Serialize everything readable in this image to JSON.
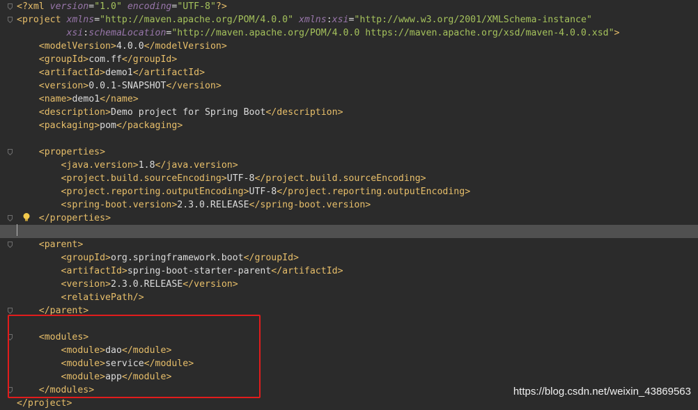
{
  "editor": {
    "lines": [
      {
        "indent": "",
        "parts": [
          [
            "lt",
            "<?"
          ],
          [
            "el",
            "xml "
          ],
          [
            "attrn",
            "version"
          ],
          [
            "txt",
            "="
          ],
          [
            "str",
            "\"1.0\""
          ],
          [
            "txt",
            " "
          ],
          [
            "attrn",
            "encoding"
          ],
          [
            "txt",
            "="
          ],
          [
            "str",
            "\"UTF-8\""
          ],
          [
            "lt",
            "?>"
          ]
        ]
      },
      {
        "indent": "",
        "parts": [
          [
            "lt",
            "<"
          ],
          [
            "el",
            "project "
          ],
          [
            "attrn",
            "xmlns"
          ],
          [
            "txt",
            "="
          ],
          [
            "str",
            "\"http://maven.apache.org/POM/4.0.0\""
          ],
          [
            "txt",
            " "
          ],
          [
            "attrn",
            "xmlns"
          ],
          [
            "txt",
            ":"
          ],
          [
            "attrn",
            "xsi"
          ],
          [
            "txt",
            "="
          ],
          [
            "str",
            "\"http://www.w3.org/2001/XMLSchema-instance\""
          ]
        ]
      },
      {
        "indent": "         ",
        "parts": [
          [
            "attrn",
            "xsi"
          ],
          [
            "txt",
            ":"
          ],
          [
            "attrn",
            "schemaLocation"
          ],
          [
            "txt",
            "="
          ],
          [
            "str",
            "\"http://maven.apache.org/POM/4.0.0 https://maven.apache.org/xsd/maven-4.0.0.xsd\""
          ],
          [
            "lt",
            ">"
          ]
        ]
      },
      {
        "indent": "    ",
        "parts": [
          [
            "lt",
            "<"
          ],
          [
            "el",
            "modelVersion"
          ],
          [
            "lt",
            ">"
          ],
          [
            "txt",
            "4.0.0"
          ],
          [
            "lt",
            "</"
          ],
          [
            "el",
            "modelVersion"
          ],
          [
            "lt",
            ">"
          ]
        ]
      },
      {
        "indent": "    ",
        "parts": [
          [
            "lt",
            "<"
          ],
          [
            "el",
            "groupId"
          ],
          [
            "lt",
            ">"
          ],
          [
            "txt",
            "com.ff"
          ],
          [
            "lt",
            "</"
          ],
          [
            "el",
            "groupId"
          ],
          [
            "lt",
            ">"
          ]
        ]
      },
      {
        "indent": "    ",
        "parts": [
          [
            "lt",
            "<"
          ],
          [
            "el",
            "artifactId"
          ],
          [
            "lt",
            ">"
          ],
          [
            "txt",
            "demo1"
          ],
          [
            "lt",
            "</"
          ],
          [
            "el",
            "artifactId"
          ],
          [
            "lt",
            ">"
          ]
        ]
      },
      {
        "indent": "    ",
        "parts": [
          [
            "lt",
            "<"
          ],
          [
            "el",
            "version"
          ],
          [
            "lt",
            ">"
          ],
          [
            "txt",
            "0.0.1-SNAPSHOT"
          ],
          [
            "lt",
            "</"
          ],
          [
            "el",
            "version"
          ],
          [
            "lt",
            ">"
          ]
        ]
      },
      {
        "indent": "    ",
        "parts": [
          [
            "lt",
            "<"
          ],
          [
            "el",
            "name"
          ],
          [
            "lt",
            ">"
          ],
          [
            "txt",
            "demo1"
          ],
          [
            "lt",
            "</"
          ],
          [
            "el",
            "name"
          ],
          [
            "lt",
            ">"
          ]
        ]
      },
      {
        "indent": "    ",
        "parts": [
          [
            "lt",
            "<"
          ],
          [
            "el",
            "description"
          ],
          [
            "lt",
            ">"
          ],
          [
            "txt",
            "Demo project for Spring Boot"
          ],
          [
            "lt",
            "</"
          ],
          [
            "el",
            "description"
          ],
          [
            "lt",
            ">"
          ]
        ]
      },
      {
        "indent": "    ",
        "parts": [
          [
            "lt",
            "<"
          ],
          [
            "el",
            "packaging"
          ],
          [
            "lt",
            ">"
          ],
          [
            "txt",
            "pom"
          ],
          [
            "lt",
            "</"
          ],
          [
            "el",
            "packaging"
          ],
          [
            "lt",
            ">"
          ]
        ]
      },
      {
        "indent": "",
        "parts": []
      },
      {
        "indent": "    ",
        "parts": [
          [
            "lt",
            "<"
          ],
          [
            "el",
            "properties"
          ],
          [
            "lt",
            ">"
          ]
        ]
      },
      {
        "indent": "        ",
        "parts": [
          [
            "lt",
            "<"
          ],
          [
            "el",
            "java.version"
          ],
          [
            "lt",
            ">"
          ],
          [
            "txt",
            "1.8"
          ],
          [
            "lt",
            "</"
          ],
          [
            "el",
            "java.version"
          ],
          [
            "lt",
            ">"
          ]
        ]
      },
      {
        "indent": "        ",
        "parts": [
          [
            "lt",
            "<"
          ],
          [
            "el",
            "project.build.sourceEncoding"
          ],
          [
            "lt",
            ">"
          ],
          [
            "txt",
            "UTF-8"
          ],
          [
            "lt",
            "</"
          ],
          [
            "el",
            "project.build.sourceEncoding"
          ],
          [
            "lt",
            ">"
          ]
        ]
      },
      {
        "indent": "        ",
        "parts": [
          [
            "lt",
            "<"
          ],
          [
            "el",
            "project.reporting.outputEncoding"
          ],
          [
            "lt",
            ">"
          ],
          [
            "txt",
            "UTF-8"
          ],
          [
            "lt",
            "</"
          ],
          [
            "el",
            "project.reporting.outputEncoding"
          ],
          [
            "lt",
            ">"
          ]
        ]
      },
      {
        "indent": "        ",
        "parts": [
          [
            "lt",
            "<"
          ],
          [
            "el",
            "spring-boot.version"
          ],
          [
            "lt",
            ">"
          ],
          [
            "txt",
            "2.3.0.RELEASE"
          ],
          [
            "lt",
            "</"
          ],
          [
            "el",
            "spring-boot.version"
          ],
          [
            "lt",
            ">"
          ]
        ]
      },
      {
        "indent": "    ",
        "parts": [
          [
            "lt",
            "</"
          ],
          [
            "el",
            "properties"
          ],
          [
            "lt",
            ">"
          ]
        ]
      },
      {
        "indent": "",
        "parts": []
      },
      {
        "indent": "    ",
        "parts": [
          [
            "lt",
            "<"
          ],
          [
            "el",
            "parent"
          ],
          [
            "lt",
            ">"
          ]
        ]
      },
      {
        "indent": "        ",
        "parts": [
          [
            "lt",
            "<"
          ],
          [
            "el",
            "groupId"
          ],
          [
            "lt",
            ">"
          ],
          [
            "txt",
            "org.springframework.boot"
          ],
          [
            "lt",
            "</"
          ],
          [
            "el",
            "groupId"
          ],
          [
            "lt",
            ">"
          ]
        ]
      },
      {
        "indent": "        ",
        "parts": [
          [
            "lt",
            "<"
          ],
          [
            "el",
            "artifactId"
          ],
          [
            "lt",
            ">"
          ],
          [
            "txt",
            "spring-boot-starter-parent"
          ],
          [
            "lt",
            "</"
          ],
          [
            "el",
            "artifactId"
          ],
          [
            "lt",
            ">"
          ]
        ]
      },
      {
        "indent": "        ",
        "parts": [
          [
            "lt",
            "<"
          ],
          [
            "el",
            "version"
          ],
          [
            "lt",
            ">"
          ],
          [
            "txt",
            "2.3.0.RELEASE"
          ],
          [
            "lt",
            "</"
          ],
          [
            "el",
            "version"
          ],
          [
            "lt",
            ">"
          ]
        ]
      },
      {
        "indent": "        ",
        "parts": [
          [
            "lt",
            "<"
          ],
          [
            "el",
            "relativePath"
          ],
          [
            "lt",
            "/>"
          ]
        ]
      },
      {
        "indent": "    ",
        "parts": [
          [
            "lt",
            "</"
          ],
          [
            "el",
            "parent"
          ],
          [
            "lt",
            ">"
          ]
        ]
      },
      {
        "indent": "",
        "parts": []
      },
      {
        "indent": "    ",
        "parts": [
          [
            "lt",
            "<"
          ],
          [
            "el",
            "modules"
          ],
          [
            "lt",
            ">"
          ]
        ]
      },
      {
        "indent": "        ",
        "parts": [
          [
            "lt",
            "<"
          ],
          [
            "el",
            "module"
          ],
          [
            "lt",
            ">"
          ],
          [
            "txt",
            "dao"
          ],
          [
            "lt",
            "</"
          ],
          [
            "el",
            "module"
          ],
          [
            "lt",
            ">"
          ]
        ]
      },
      {
        "indent": "        ",
        "parts": [
          [
            "lt",
            "<"
          ],
          [
            "el",
            "module"
          ],
          [
            "lt",
            ">"
          ],
          [
            "txt",
            "service"
          ],
          [
            "lt",
            "</"
          ],
          [
            "el",
            "module"
          ],
          [
            "lt",
            ">"
          ]
        ]
      },
      {
        "indent": "        ",
        "parts": [
          [
            "lt",
            "<"
          ],
          [
            "el",
            "module"
          ],
          [
            "lt",
            ">"
          ],
          [
            "txt",
            "app"
          ],
          [
            "lt",
            "</"
          ],
          [
            "el",
            "module"
          ],
          [
            "lt",
            ">"
          ]
        ]
      },
      {
        "indent": "    ",
        "parts": [
          [
            "lt",
            "</"
          ],
          [
            "el",
            "modules"
          ],
          [
            "lt",
            ">"
          ]
        ]
      },
      {
        "indent": "",
        "parts": [
          [
            "lt",
            "</"
          ],
          [
            "el",
            "project"
          ],
          [
            "lt",
            ">"
          ]
        ]
      }
    ]
  },
  "colors": {
    "background": "#2b2b2b",
    "current_line": "#505050",
    "tag": "#e8bf6a",
    "text": "#dcdcdc",
    "attribute": "#9876aa",
    "string": "#a5c25c",
    "highlight_box": "#e21c1c"
  },
  "icons": {
    "bulb": "lightbulb-icon",
    "fold": "fold-marker-icon"
  },
  "watermark": "https://blog.csdn.net/weixin_43869563"
}
